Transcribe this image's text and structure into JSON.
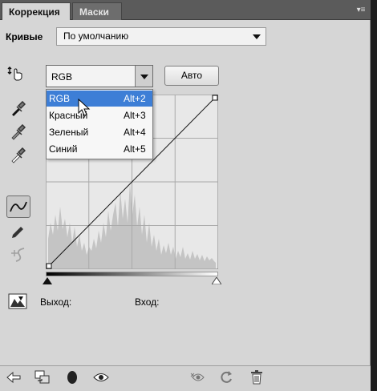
{
  "tabs": [
    {
      "label": "Коррекция",
      "active": true
    },
    {
      "label": "Маски",
      "active": false
    }
  ],
  "preset": {
    "label": "Кривые",
    "value": "По умолчанию"
  },
  "channel": {
    "value": "RGB",
    "options": [
      {
        "name": "RGB",
        "shortcut": "Alt+2",
        "highlighted": true
      },
      {
        "name": "Красный",
        "shortcut": "Alt+3"
      },
      {
        "name": "Зеленый",
        "shortcut": "Alt+4"
      },
      {
        "name": "Синий",
        "shortcut": "Alt+5"
      }
    ]
  },
  "auto_button": "Авто",
  "output_label": "Выход:",
  "input_label": "Вход:",
  "tools": [
    "finger-adjust-icon",
    "black-eyedropper-icon",
    "gray-eyedropper-icon",
    "white-eyedropper-icon",
    "curve-point-icon",
    "pencil-icon",
    "smooth-icon",
    "clipping-warning-icon"
  ],
  "footer_icons": [
    "back-arrow-icon",
    "clip-to-layer-icon",
    "view-previous-icon",
    "visibility-eye-icon",
    "reset-icon",
    "refresh-icon",
    "trash-icon"
  ],
  "colors": {
    "highlight": "#3d7ed6",
    "panel": "#d6d6d6",
    "tabbar": "#5b5b5b"
  }
}
